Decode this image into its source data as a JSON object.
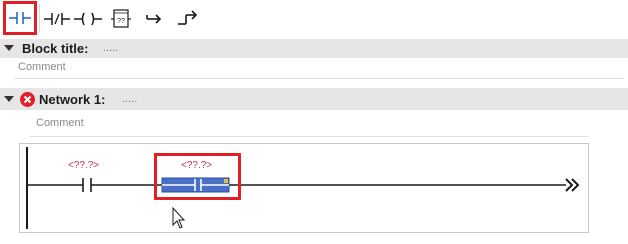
{
  "toolbar": {
    "buttons": [
      {
        "name": "normally-open-contact-icon",
        "selected": true
      },
      {
        "name": "normally-closed-contact-icon",
        "selected": false
      },
      {
        "name": "output-coil-icon",
        "selected": false
      },
      {
        "name": "empty-box-icon",
        "selected": false,
        "text": "??"
      },
      {
        "name": "open-branch-icon",
        "selected": false
      },
      {
        "name": "close-branch-icon",
        "selected": false
      }
    ]
  },
  "block": {
    "title_label": "Block title:",
    "title_value": ".....",
    "comment": "Comment"
  },
  "network": {
    "title_label": "Network 1:",
    "title_value": ".....",
    "comment": "Comment",
    "status": "error",
    "contact_operand": "<??.?>",
    "box_operand": "<??.?>",
    "rung_end_symbol": "»"
  },
  "colors": {
    "accent_red": "#e01f27",
    "error_red": "#e2202a",
    "operand_red": "#c0334d",
    "box_blue": "#4a6fc7"
  }
}
